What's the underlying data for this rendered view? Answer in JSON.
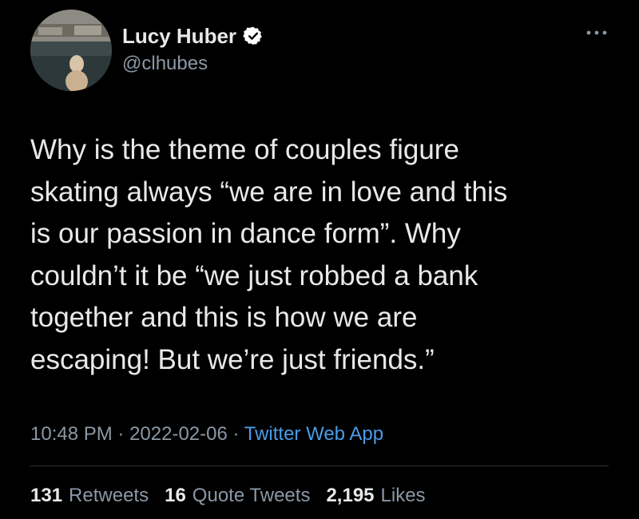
{
  "author": {
    "display_name": "Lucy Huber",
    "handle": "@clhubes",
    "verified": true
  },
  "tweet": {
    "text": "Why is the theme of couples figure\nskating always “we are in love and this\nis our passion in dance form”. Why\ncouldn’t it be “we just robbed a bank\ntogether and this is how we are\nescaping! But we’re just friends.”",
    "time": "10:48 PM",
    "date": "2022-02-06",
    "separator": "·",
    "source": "Twitter Web App"
  },
  "stats": {
    "retweets_count": "131",
    "retweets_label": "Retweets",
    "quotes_count": "16",
    "quotes_label": "Quote Tweets",
    "likes_count": "2,195",
    "likes_label": "Likes"
  },
  "icons": {
    "verified": "verified-badge-icon",
    "more": "more-options-icon"
  },
  "colors": {
    "background": "#000000",
    "text_primary": "#e7e9ea",
    "text_secondary": "#8b98a5",
    "link": "#4a9ce8",
    "divider": "#2f3336",
    "verified_badge": "#ffffff"
  }
}
